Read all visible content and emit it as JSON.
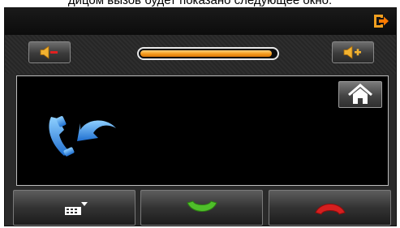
{
  "caption": "дицом вызов будет показано следующее окно:",
  "icons": {
    "exit": "exit-icon",
    "volume_down": "volume-down-icon",
    "volume_up": "volume-up-icon",
    "home": "home-icon",
    "call_status": "incoming-call-icon",
    "keypad": "keypad-icon",
    "answer": "answer-call-icon",
    "hangup": "hang-up-icon"
  },
  "volume": {
    "level_fraction": 0.97
  },
  "colors": {
    "accent": "#f59a1c",
    "answer": "#4fbf2a",
    "hangup": "#d61f1f",
    "call_icon": "#2f8fe0"
  }
}
